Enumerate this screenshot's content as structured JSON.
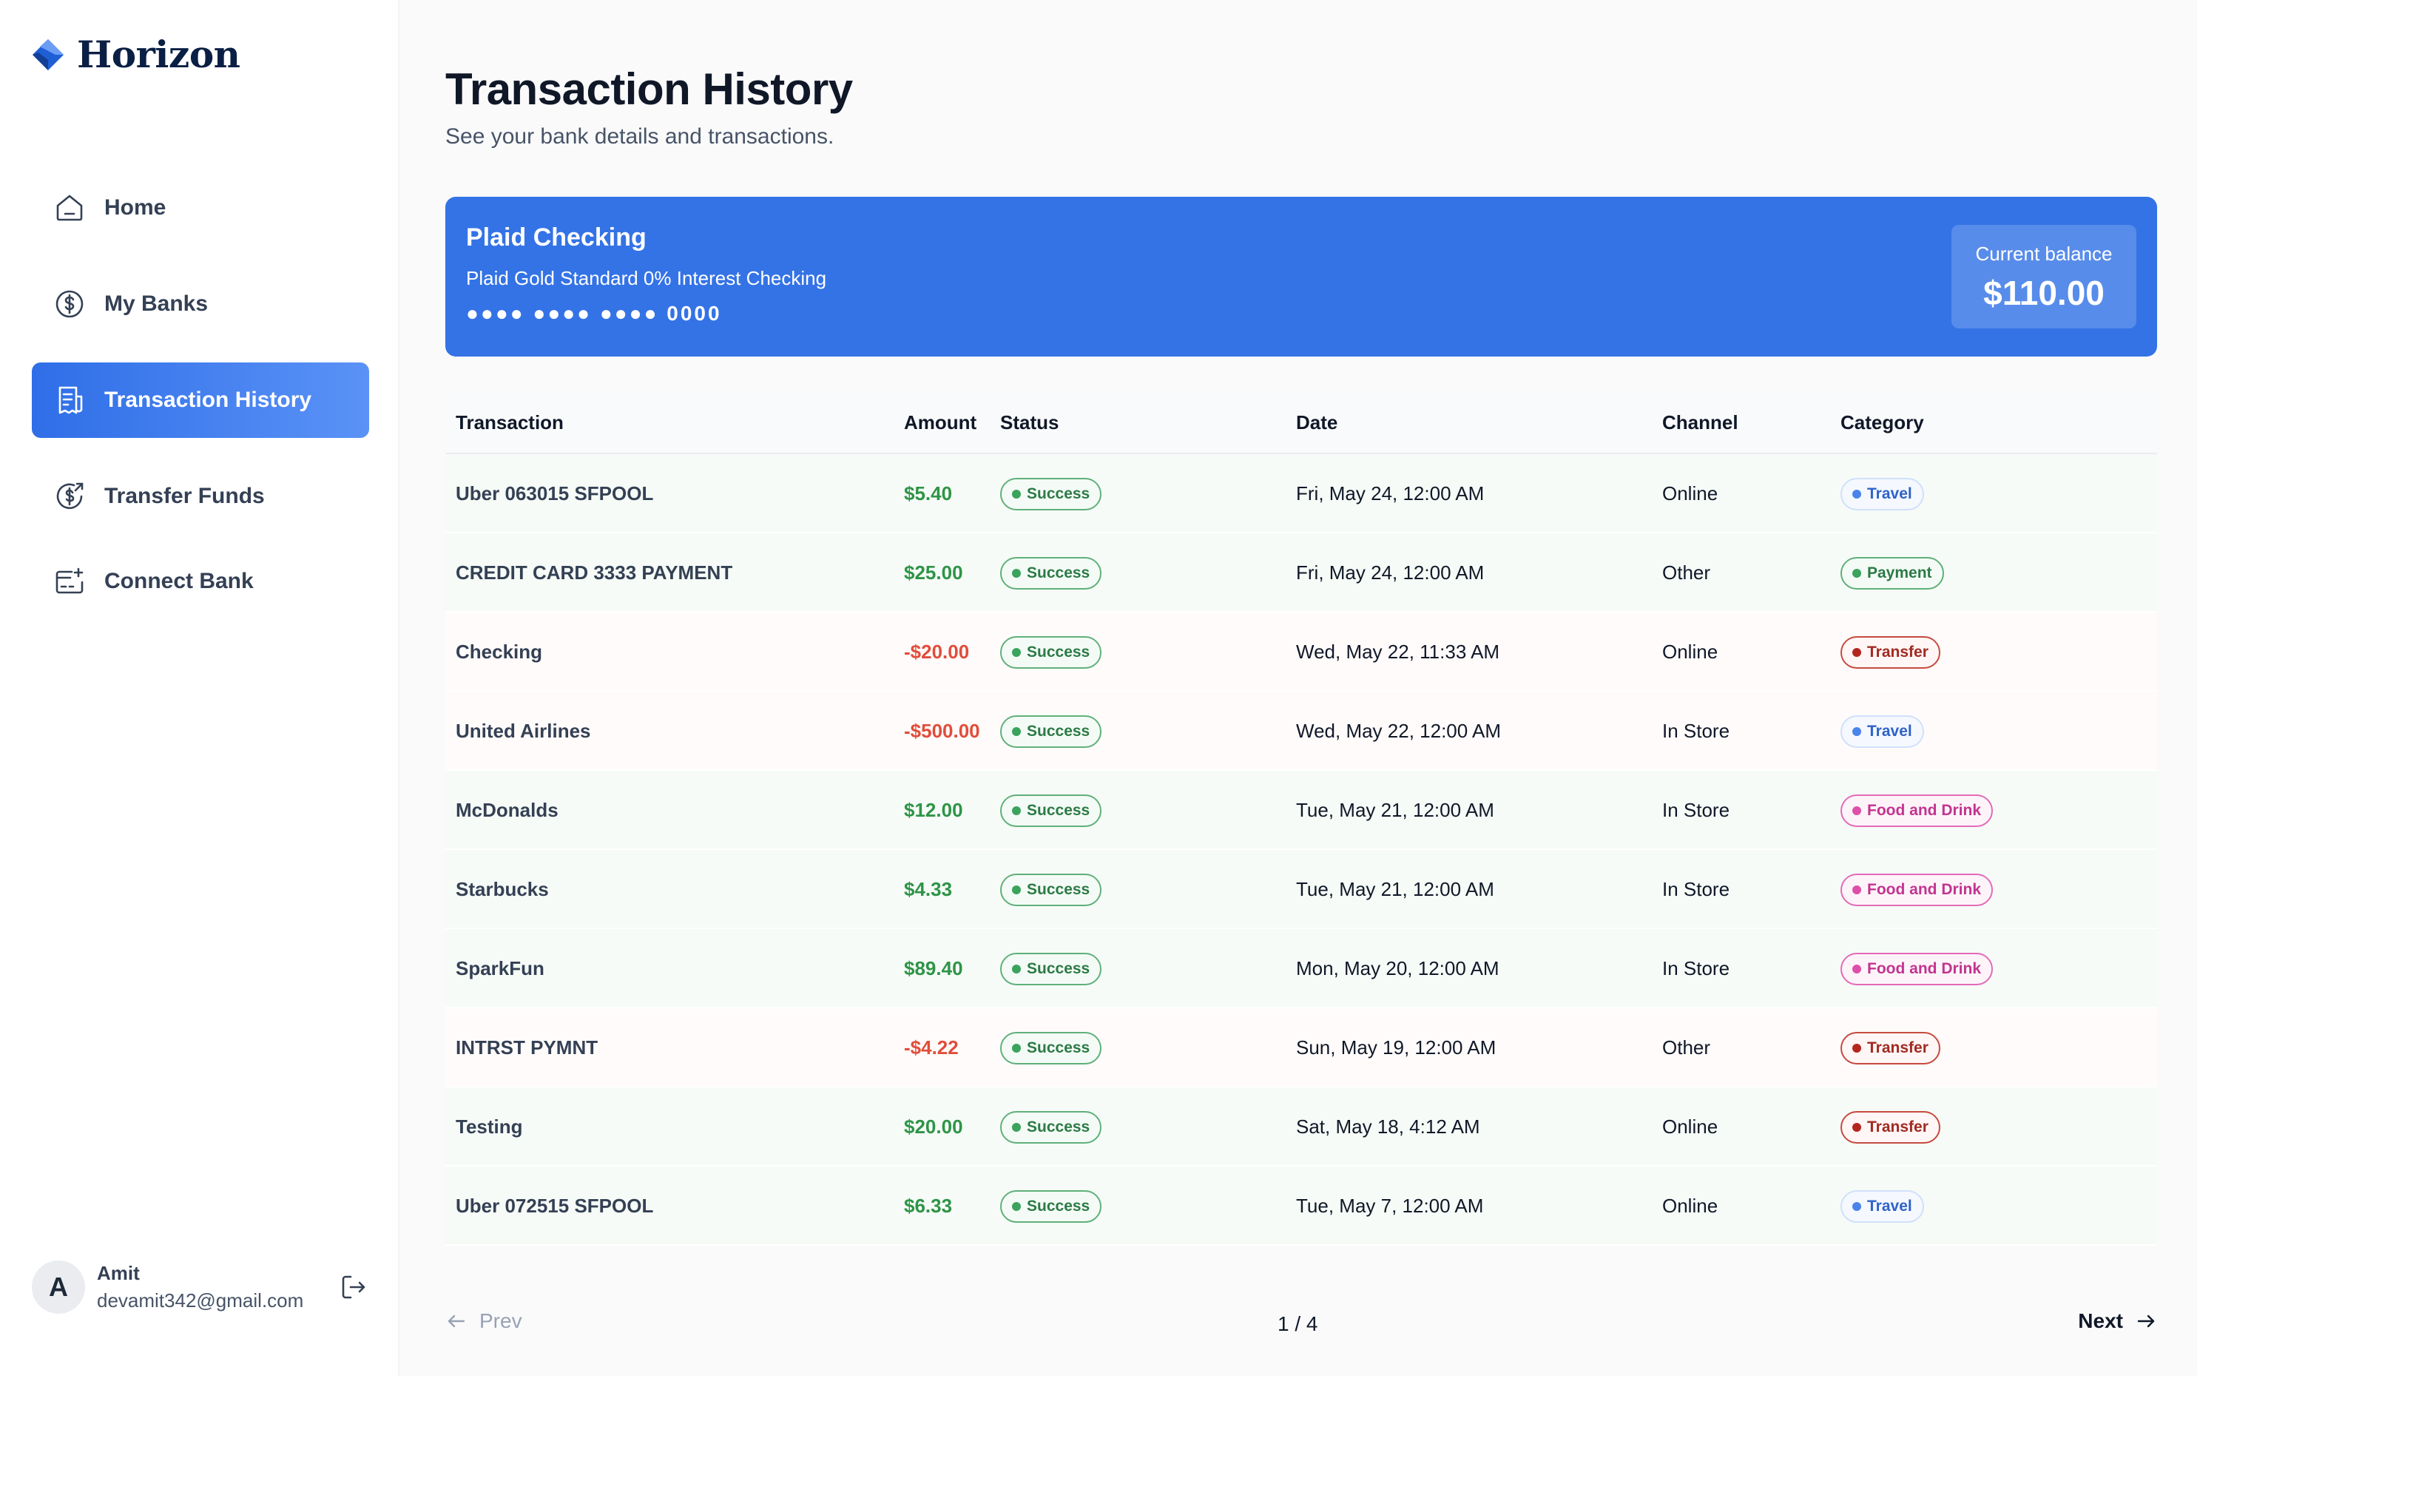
{
  "app": {
    "brand": "Horizon"
  },
  "sidebar": {
    "items": [
      {
        "label": "Home",
        "icon": "home-icon"
      },
      {
        "label": "My Banks",
        "icon": "dollar-circle-icon"
      },
      {
        "label": "Transaction History",
        "icon": "receipt-icon",
        "active": true
      },
      {
        "label": "Transfer Funds",
        "icon": "money-send-icon"
      },
      {
        "label": "Connect Bank",
        "icon": "card-add-icon"
      }
    ]
  },
  "user": {
    "initial": "A",
    "name": "Amit",
    "email": "devamit342@gmail.com"
  },
  "header": {
    "title": "Transaction History",
    "subtitle": "See your bank details and transactions."
  },
  "bank": {
    "name": "Plaid Checking",
    "official_name": "Plaid Gold Standard 0% Interest Checking",
    "mask": "●●●● ●●●● ●●●● 0000",
    "balance_label": "Current balance",
    "balance": "$110.00"
  },
  "table": {
    "columns": [
      "Transaction",
      "Amount",
      "Status",
      "Date",
      "Channel",
      "Category"
    ],
    "rows": [
      {
        "name": "Uber 063015 SFPOOL",
        "amount": "$5.40",
        "type": "pos",
        "status": "Success",
        "date": "Fri, May 24, 12:00 AM",
        "channel": "Online",
        "category": "Travel"
      },
      {
        "name": "CREDIT CARD 3333 PAYMENT",
        "amount": "$25.00",
        "type": "pos",
        "status": "Success",
        "date": "Fri, May 24, 12:00 AM",
        "channel": "Other",
        "category": "Payment"
      },
      {
        "name": "Checking",
        "amount": "-$20.00",
        "type": "neg",
        "status": "Success",
        "date": "Wed, May 22, 11:33 AM",
        "channel": "Online",
        "category": "Transfer"
      },
      {
        "name": "United Airlines",
        "amount": "-$500.00",
        "type": "neg",
        "status": "Success",
        "date": "Wed, May 22, 12:00 AM",
        "channel": "In Store",
        "category": "Travel"
      },
      {
        "name": "McDonalds",
        "amount": "$12.00",
        "type": "pos",
        "status": "Success",
        "date": "Tue, May 21, 12:00 AM",
        "channel": "In Store",
        "category": "Food and Drink"
      },
      {
        "name": "Starbucks",
        "amount": "$4.33",
        "type": "pos",
        "status": "Success",
        "date": "Tue, May 21, 12:00 AM",
        "channel": "In Store",
        "category": "Food and Drink"
      },
      {
        "name": "SparkFun",
        "amount": "$89.40",
        "type": "pos",
        "status": "Success",
        "date": "Mon, May 20, 12:00 AM",
        "channel": "In Store",
        "category": "Food and Drink"
      },
      {
        "name": "INTRST PYMNT",
        "amount": "-$4.22",
        "type": "neg",
        "status": "Success",
        "date": "Sun, May 19, 12:00 AM",
        "channel": "Other",
        "category": "Transfer"
      },
      {
        "name": "Testing",
        "amount": "$20.00",
        "type": "pos",
        "status": "Success",
        "date": "Sat, May 18, 4:12 AM",
        "channel": "Online",
        "category": "Transfer"
      },
      {
        "name": "Uber 072515 SFPOOL",
        "amount": "$6.33",
        "type": "pos",
        "status": "Success",
        "date": "Tue, May 7, 12:00 AM",
        "channel": "Online",
        "category": "Travel"
      }
    ]
  },
  "category_styles": {
    "Travel": {
      "border": "#d0e0fb",
      "text": "#2f63c9",
      "dot": "#4a84ea",
      "bg": "#f5f8ff"
    },
    "Payment": {
      "border": "#5fb07a",
      "text": "#2c7a45",
      "dot": "#3aa35c",
      "bg": "#f4fbf6"
    },
    "Transfer": {
      "border": "#c64a3f",
      "text": "#a12a22",
      "dot": "#b3261e",
      "bg": "#fff6f5"
    },
    "Food and Drink": {
      "border": "#e46ab8",
      "text": "#c2348f",
      "dot": "#de4fa9",
      "bg": "#fdf4fa"
    }
  },
  "pagination": {
    "prev": "Prev",
    "next": "Next",
    "page": "1 / 4"
  },
  "colors": {
    "accent": "#3473e6",
    "positive": "#2e9447",
    "negative": "#e04e3a"
  }
}
